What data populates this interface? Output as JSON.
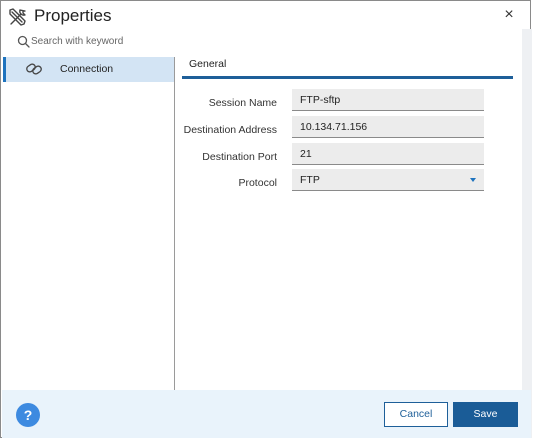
{
  "window": {
    "title": "Properties",
    "close_glyph": "×"
  },
  "search": {
    "placeholder": "Search with keyword",
    "value": ""
  },
  "sidebar": {
    "items": [
      {
        "label": "Connection",
        "icon": "link-icon",
        "selected": true
      }
    ]
  },
  "tabs": [
    {
      "label": "General",
      "active": true
    }
  ],
  "form": {
    "session_name": {
      "label": "Session Name",
      "value": "FTP-sftp"
    },
    "destination_address": {
      "label": "Destination Address",
      "value": "10.134.71.156"
    },
    "destination_port": {
      "label": "Destination Port",
      "value": "21"
    },
    "protocol": {
      "label": "Protocol",
      "value": "FTP"
    }
  },
  "footer": {
    "help_glyph": "?",
    "cancel_label": "Cancel",
    "save_label": "Save"
  },
  "colors": {
    "accent": "#1e73be",
    "primary_button": "#1a5c97",
    "selected_item_bg": "#d3e4f4",
    "footer_bg": "#e9f3fb",
    "field_bg": "#ececec"
  }
}
